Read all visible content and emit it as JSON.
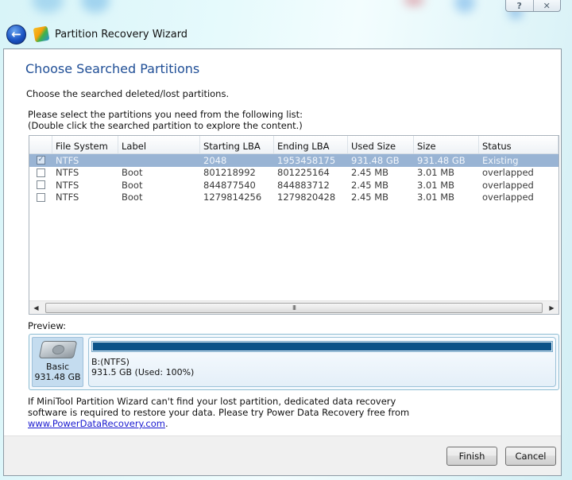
{
  "window": {
    "title": "Partition Recovery Wizard",
    "help_icon": "?",
    "close_icon": "✕",
    "back_icon": "←"
  },
  "page": {
    "heading": "Choose Searched Partitions",
    "subheading": "Choose the searched deleted/lost partitions.",
    "instruction_line1": "Please select the partitions you need from the following list:",
    "instruction_line2": "(Double click the searched partition to explore the content.)"
  },
  "table": {
    "columns": [
      "",
      "File System",
      "Label",
      "Starting LBA",
      "Ending LBA",
      "Used Size",
      "Size",
      "Status"
    ],
    "rows": [
      {
        "checked": true,
        "selected": true,
        "file_system": "NTFS",
        "label": "",
        "starting_lba": "2048",
        "ending_lba": "1953458175",
        "used_size": "931.48 GB",
        "size": "931.48 GB",
        "status": "Existing"
      },
      {
        "checked": false,
        "selected": false,
        "file_system": "NTFS",
        "label": "Boot",
        "starting_lba": "801218992",
        "ending_lba": "801225164",
        "used_size": "2.45 MB",
        "size": "3.01 MB",
        "status": "overlapped"
      },
      {
        "checked": false,
        "selected": false,
        "file_system": "NTFS",
        "label": "Boot",
        "starting_lba": "844877540",
        "ending_lba": "844883712",
        "used_size": "2.45 MB",
        "size": "3.01 MB",
        "status": "overlapped"
      },
      {
        "checked": false,
        "selected": false,
        "file_system": "NTFS",
        "label": "Boot",
        "starting_lba": "1279814256",
        "ending_lba": "1279820428",
        "used_size": "2.45 MB",
        "size": "3.01 MB",
        "status": "overlapped"
      }
    ],
    "scroll_left_icon": "◀",
    "scroll_right_icon": "▶",
    "scroll_grip": "III"
  },
  "preview": {
    "label": "Preview:",
    "disk_type": "Basic",
    "disk_size": "931.48 GB",
    "partition_name": "B:(NTFS)",
    "partition_info": "931.5 GB (Used: 100%)",
    "used_percent": 100,
    "fill_color": "#0a5288"
  },
  "info": {
    "text_line1": "If MiniTool Partition Wizard can't find your lost partition, dedicated data recovery",
    "text_line2": "software is required to restore your data. Please try Power Data Recovery free from",
    "link": "www.PowerDataRecovery.com",
    "link_suffix": "."
  },
  "buttons": {
    "finish": "Finish",
    "cancel": "Cancel"
  },
  "colors": {
    "heading": "#1f4e96",
    "selected_row": "#99b4d4",
    "link": "#1a1ad0"
  }
}
